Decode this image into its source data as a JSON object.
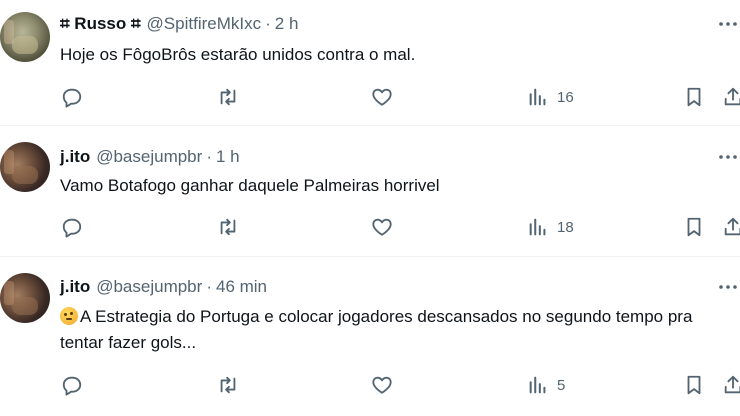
{
  "tweets": [
    {
      "name": "⌗ Russo ⌗",
      "handle": "@SpitfireMkIxc",
      "separator": "·",
      "time": "2 h",
      "text": "Hoje os FôgoBrôs estarão unidos contra o mal.",
      "views": "16"
    },
    {
      "name": "j.ito",
      "handle": "@basejumpbr",
      "separator": "·",
      "time": "1 h",
      "text": "Vamo Botafogo ganhar daquele Palmeiras horrivel",
      "views": "18"
    },
    {
      "name": "j.ito",
      "handle": "@basejumpbr",
      "separator": "·",
      "time": "46 min",
      "text": "A Estrategia do Portuga e colocar jogadores descansados no segundo tempo pra tentar fazer gols...",
      "views": "5"
    }
  ],
  "icons": {
    "more": "more-icon",
    "reply": "reply-icon",
    "retweet": "retweet-icon",
    "like": "heart-icon",
    "views": "views-icon",
    "bookmark": "bookmark-icon",
    "share": "share-icon",
    "emoji": "thinking-face-emoji"
  },
  "colors": {
    "text": "#0f1419",
    "secondary": "#536471",
    "divider": "#eff3f4",
    "background": "#ffffff"
  }
}
